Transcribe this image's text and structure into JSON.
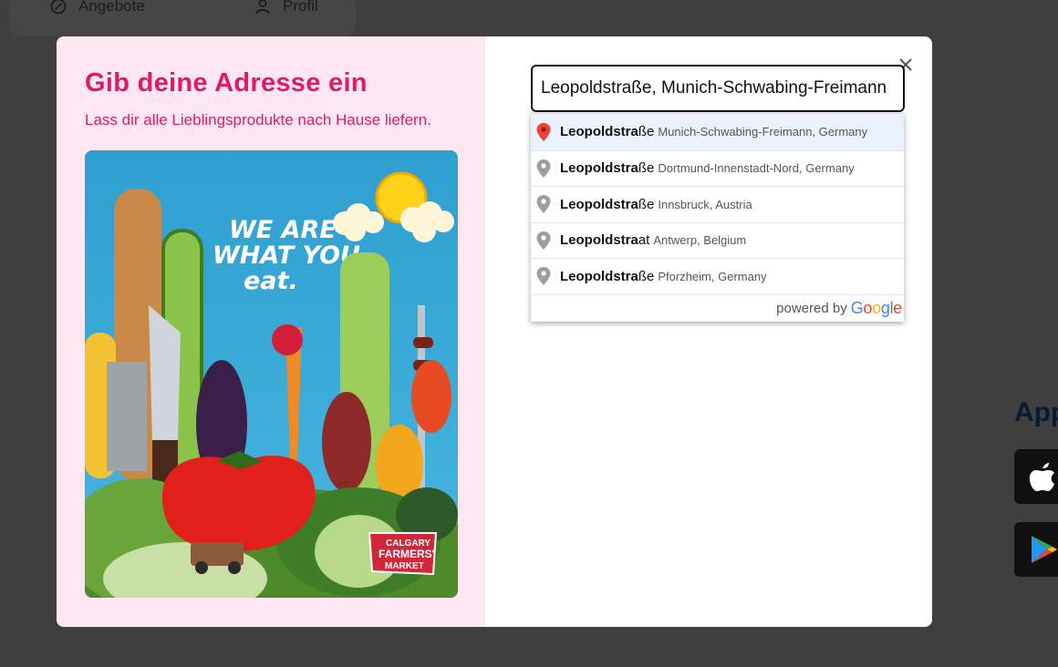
{
  "background": {
    "nav": {
      "offers_label": "Angebote",
      "profile_label": "Profil"
    },
    "app_section_title": "App"
  },
  "modal": {
    "title": "Gib deine Adresse ein",
    "subtitle": "Lass dir alle Lieblingsprodukte nach Hause liefern.",
    "poster": {
      "headline_line1": "WE ARE",
      "headline_line2": "WHAT YOU",
      "headline_line3": "eat.",
      "brand_line1": "CALGARY",
      "brand_line2": "FARMERS'",
      "brand_line3": "MARKET"
    },
    "search": {
      "value": "Leopoldstraße, Munich-Schwabing-Freimann",
      "close_icon": "close-icon"
    },
    "suggestions": [
      {
        "match": "Leopoldstra",
        "rest": "ße",
        "secondary": "Munich-Schwabing-Freimann, Germany",
        "active": true
      },
      {
        "match": "Leopoldstra",
        "rest": "ße",
        "secondary": "Dortmund-Innenstadt-Nord, Germany",
        "active": false
      },
      {
        "match": "Leopoldstra",
        "rest": "ße",
        "secondary": "Innsbruck, Austria",
        "active": false
      },
      {
        "match": "Leopoldstra",
        "rest": "at",
        "secondary": "Antwerp, Belgium",
        "active": false
      },
      {
        "match": "Leopoldstra",
        "rest": "ße",
        "secondary": "Pforzheim, Germany",
        "active": false
      }
    ],
    "powered_by": "powered by",
    "google_logo": "Google"
  },
  "colors": {
    "accent": "#e0196b",
    "left_panel_bg": "#fde8f1",
    "active_pin": "#ea4335",
    "inactive_pin": "#9e9e9e"
  }
}
